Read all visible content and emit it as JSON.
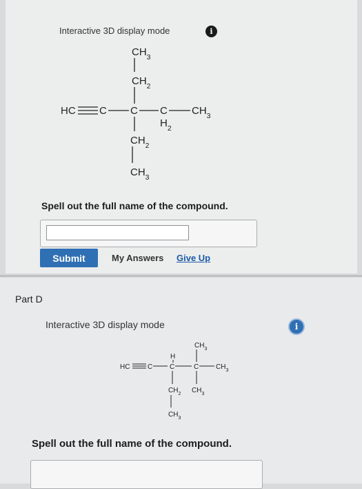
{
  "part_c": {
    "mode_label": "Interactive 3D display mode",
    "info_icon": "info-icon",
    "structure": {
      "top_ch3": "CH3",
      "top_ch2": "CH2",
      "left": "HC",
      "c1": "C",
      "c2": "C",
      "c3": "C",
      "h2": "H2",
      "right_ch3": "CH3",
      "bottom_ch2": "CH2",
      "bottom_ch3": "CH3"
    },
    "prompt": "Spell out the full name of the compound.",
    "answer_value": "",
    "submit_label": "Submit",
    "my_answers_label": "My Answers",
    "give_up_label": "Give Up"
  },
  "part_d": {
    "title": "Part D",
    "mode_label": "Interactive 3D display mode",
    "structure": {
      "top_ch3": "CH3",
      "left": "HC",
      "c1": "C",
      "h": "H",
      "c2": "C",
      "c3": "C",
      "right_ch3": "CH3",
      "ch2": "CH2",
      "ch3_mid": "CH3",
      "bottom_ch3": "CH3"
    },
    "prompt": "Spell out the full name of the compound."
  },
  "colors": {
    "submit_bg": "#2f6fb4",
    "link": "#1b5ba8",
    "info_c": "#1a1a1a",
    "info_d": "#2f6fb4"
  }
}
